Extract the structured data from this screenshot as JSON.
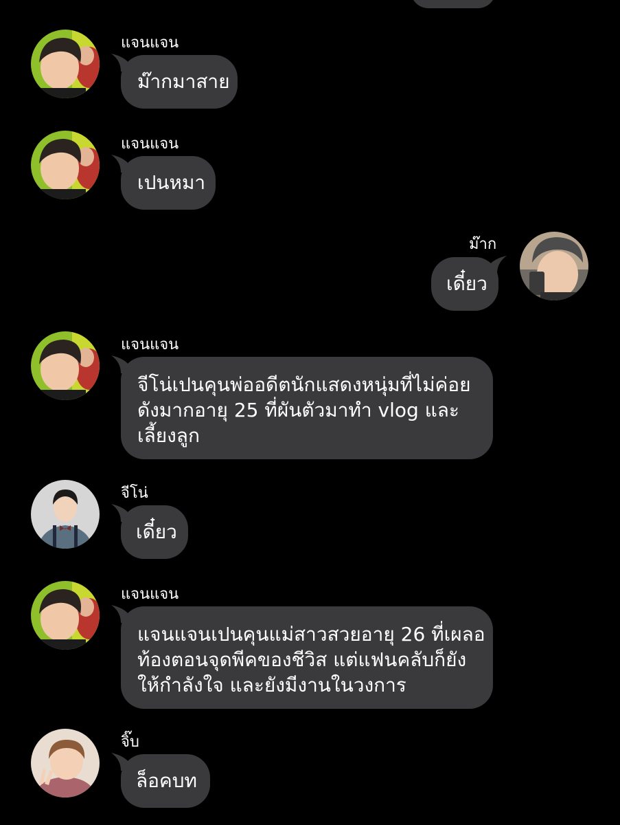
{
  "messages": [
    {
      "sender": "",
      "lines": []
    },
    {
      "sender": "แจนแจน",
      "lines": [
        "ม๊ากมาสาย"
      ]
    },
    {
      "sender": "แจนแจน",
      "lines": [
        "เปนหมา"
      ]
    },
    {
      "sender": "ม๊าก",
      "lines": [
        "เดี๋ยว"
      ]
    },
    {
      "sender": "แจนแจน",
      "lines": [
        "จีโน่เปนคุนพ่ออดีตนักแสดงหนุ่มที่ไม่ค่อย",
        "ดังมากอายุ 25 ที่ผันตัวมาทำ vlog และ",
        "เลี้ยงลูก"
      ]
    },
    {
      "sender": "จีโน่",
      "lines": [
        "เดี๋ยว"
      ]
    },
    {
      "sender": "แจนแจน",
      "lines": [
        "แจนแจนเปนคุนแม่สาวสวยอายุ 26 ที่เผลอ",
        "ท้องตอนจุดพีคของชีวิส แต่แฟนคลับก็ยัง",
        "ให้กำลังใจ และยังมีงานในวงการ"
      ]
    },
    {
      "sender": "จิ๊บ",
      "lines": [
        "ล็อคบท"
      ]
    }
  ],
  "colors": {
    "background": "#000000",
    "bubble": "#3a3a3c",
    "text": "#ffffff"
  }
}
